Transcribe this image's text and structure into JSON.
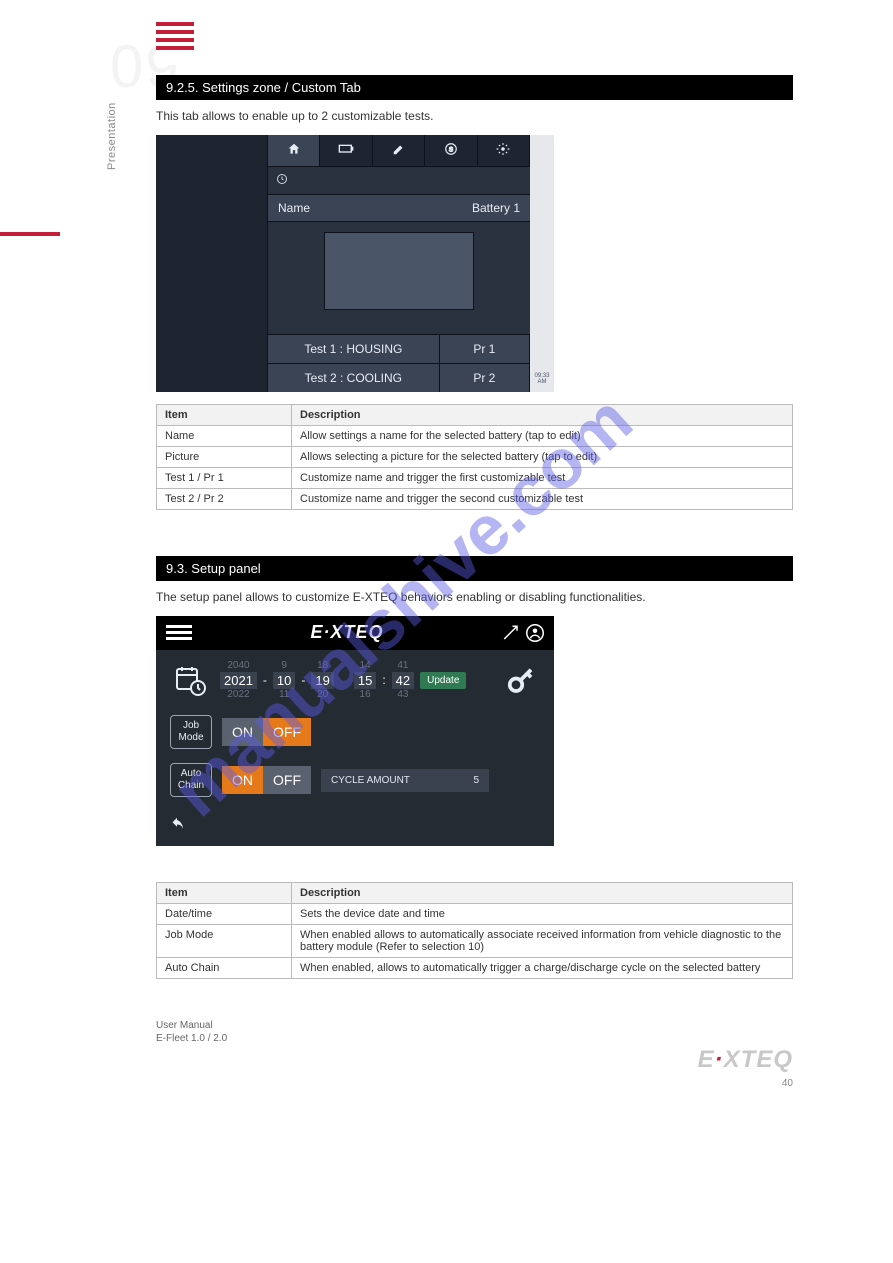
{
  "page": {
    "big_number": "09",
    "side_label": "Presentation",
    "page_number": "40"
  },
  "section1": {
    "title": "9.2.5. Settings zone / Custom Tab",
    "desc": "This tab allows to enable up to 2 customizable tests.",
    "shot": {
      "name_label": "Name",
      "name_value": "Battery 1",
      "test1": "Test 1 : HOUSING",
      "pr1": "Pr 1",
      "test2": "Test 2 : COOLING",
      "pr2": "Pr 2",
      "time": "09:33",
      "ampm": "AM"
    },
    "table": {
      "h1": "Item",
      "h2": "Description",
      "rows": [
        {
          "k": "Name",
          "v": "Allow settings a name for the selected battery (tap to edit)"
        },
        {
          "k": "Picture",
          "v": "Allows selecting a picture for the selected battery (tap to edit)"
        },
        {
          "k": "Test 1 / Pr 1",
          "v": "Customize name and trigger the first customizable test"
        },
        {
          "k": "Test 2 / Pr 2",
          "v": "Customize name and trigger the second customizable test"
        }
      ]
    }
  },
  "section2": {
    "title": "9.3. Setup panel",
    "desc": "The setup panel allows to customize E-XTEQ behaviors enabling or disabling functionalities.",
    "shot": {
      "logo": "E·XTEQ",
      "date": {
        "y": "2021",
        "m": "10",
        "d": "19",
        "h": "15",
        "min": "42",
        "fy": "2040",
        "fm": "9",
        "fd": "18",
        "fh": "14",
        "fmin": "41",
        "by": "2022",
        "bm": "11",
        "bd": "20",
        "bh": "16",
        "bmin": "43"
      },
      "update": "Update",
      "job_mode": "Job\nMode",
      "auto_chain": "Auto\nChain",
      "on": "ON",
      "off": "OFF",
      "cycle_label": "CYCLE AMOUNT",
      "cycle_value": "5"
    },
    "table": {
      "h1": "Item",
      "h2": "Description",
      "rows": [
        {
          "k": "Date/time",
          "v": "Sets the device date and time"
        },
        {
          "k": "Job Mode",
          "v": "When enabled allows to automatically associate received information from vehicle diagnostic to the battery module (Refer to selection 10)"
        },
        {
          "k": "Auto Chain",
          "v": "When enabled, allows to automatically trigger a charge/discharge cycle on the selected battery"
        }
      ]
    }
  },
  "footer": {
    "line1": "User Manual",
    "line2": "E-Fleet 1.0 / 2.0",
    "logo": "E·XTEQ"
  },
  "watermark": "manualshive.com"
}
